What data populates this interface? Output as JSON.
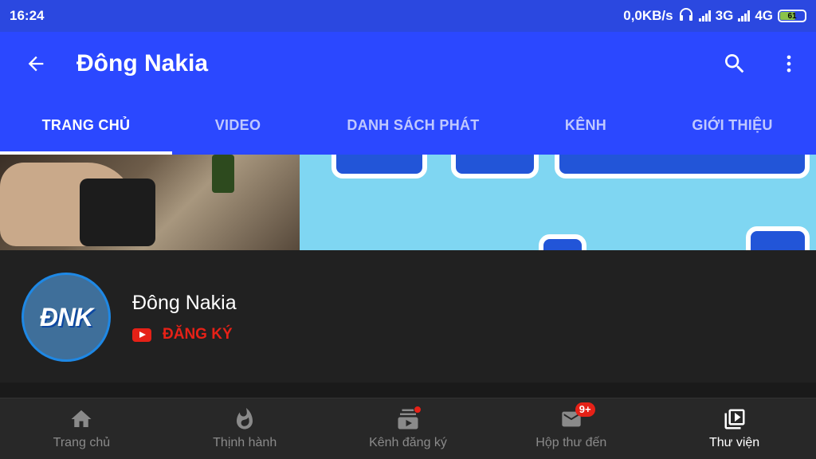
{
  "status_bar": {
    "time": "16:24",
    "net_speed": "0,0KB/s",
    "network_1": "3G",
    "network_2": "4G",
    "battery": "61"
  },
  "app_bar": {
    "title": "Đông Nakia",
    "icons": [
      "back-arrow-icon",
      "search-icon",
      "more-vert-icon"
    ]
  },
  "tabs": [
    {
      "label": "TRANG CHỦ",
      "active": true
    },
    {
      "label": "VIDEO",
      "active": false
    },
    {
      "label": "DANH SÁCH PHÁT",
      "active": false
    },
    {
      "label": "KÊNH",
      "active": false
    },
    {
      "label": "GIỚI THIỆU",
      "active": false
    }
  ],
  "channel": {
    "avatar_text": "ĐNK",
    "name": "Đông Nakia",
    "subscribe_label": "ĐĂNG KÝ"
  },
  "bottom_nav": [
    {
      "label": "Trang chủ",
      "icon": "home-icon",
      "active": false
    },
    {
      "label": "Thịnh hành",
      "icon": "fire-icon",
      "active": false
    },
    {
      "label": "Kênh đăng ký",
      "icon": "subscriptions-icon",
      "active": false
    },
    {
      "label": "Hộp thư đến",
      "icon": "mail-icon",
      "active": false,
      "badge": "9+"
    },
    {
      "label": "Thư viện",
      "icon": "library-icon",
      "active": true
    }
  ],
  "colors": {
    "accent": "#2b48ff",
    "subscribe_red": "#e62117",
    "background": "#212121"
  }
}
